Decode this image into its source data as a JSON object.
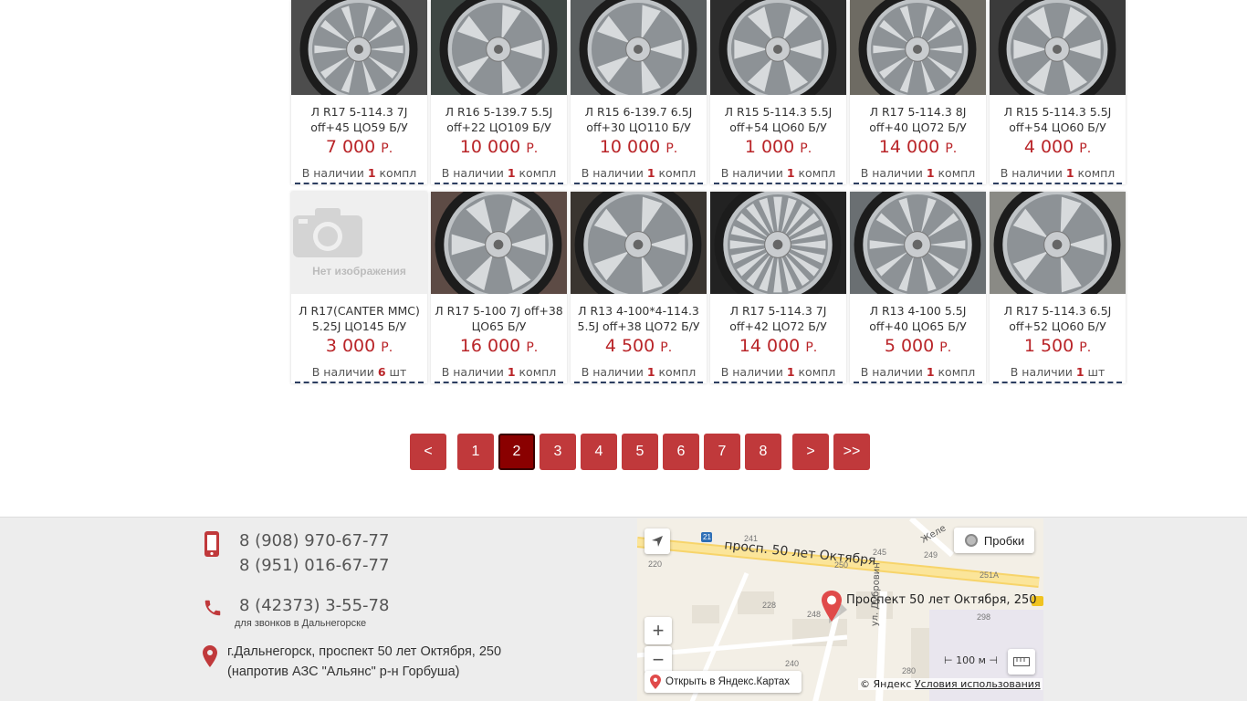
{
  "currency": "Р.",
  "stock_prefix": "В наличии",
  "rows": [
    [
      {
        "title_line1": "Л R17 5-114.3 7J",
        "title_line2": "off+45 ЦО59 Б/У",
        "price": "7 000",
        "qty": "1",
        "unit": "компл"
      },
      {
        "title_line1": "Л R16 5-139.7 5.5J",
        "title_line2": "off+22 ЦО109 Б/У",
        "price": "10 000",
        "qty": "1",
        "unit": "компл"
      },
      {
        "title_line1": "Л R15 6-139.7 6.5J",
        "title_line2": "off+30 ЦО110 Б/У",
        "price": "10 000",
        "qty": "1",
        "unit": "компл"
      },
      {
        "title_line1": "Л R15 5-114.3 5.5J",
        "title_line2": "off+54 ЦО60 Б/У",
        "price": "1 000",
        "qty": "1",
        "unit": "компл"
      },
      {
        "title_line1": "Л R17 5-114.3 8J",
        "title_line2": "off+40 ЦО72 Б/У",
        "price": "14 000",
        "qty": "1",
        "unit": "компл"
      },
      {
        "title_line1": "Л R15 5-114.3 5.5J",
        "title_line2": "off+54 ЦО60 Б/У",
        "price": "4 000",
        "qty": "1",
        "unit": "компл"
      }
    ],
    [
      {
        "title_line1": "Л R17(CANTER MMC)",
        "title_line2": "5.25J ЦО145 Б/У",
        "price": "3 000",
        "qty": "6",
        "unit": "шт"
      },
      {
        "title_line1": "Л R17 5-100 7J off+38",
        "title_line2": "ЦО65 Б/У",
        "price": "16 000",
        "qty": "1",
        "unit": "компл"
      },
      {
        "title_line1": "Л R13 4-100*4-114.3",
        "title_line2": "5.5J off+38 ЦО72 Б/У",
        "price": "4 500",
        "qty": "1",
        "unit": "компл"
      },
      {
        "title_line1": "Л R17 5-114.3 7J",
        "title_line2": "off+42 ЦО72 Б/У",
        "price": "14 000",
        "qty": "1",
        "unit": "компл"
      },
      {
        "title_line1": "Л R13 4-100 5.5J",
        "title_line2": "off+40 ЦО65 Б/У",
        "price": "5 000",
        "qty": "1",
        "unit": "компл"
      },
      {
        "title_line1": "Л R17 5-114.3 6.5J",
        "title_line2": "off+52 ЦО60 Б/У",
        "price": "1 500",
        "qty": "1",
        "unit": "шт"
      }
    ]
  ],
  "no_image_text": "Нет изображения",
  "pagination": {
    "prev": "<",
    "pages": [
      "1",
      "2",
      "3",
      "4",
      "5",
      "6",
      "7",
      "8"
    ],
    "current": "2",
    "next": ">",
    "last": ">>"
  },
  "footer": {
    "mobile1": "8 (908) 970-67-77",
    "mobile2": "8 (951) 016-67-77",
    "landline": "8 (42373) 3-55-78",
    "landline_note": "для звонков в Дальнегорске",
    "address_line1": "г.Дальнегорск, проспект 50 лет Октября, 250",
    "address_line2": "(напротив АЗС \"Альянс\" р-н Горбуша)"
  },
  "map": {
    "traffic_label": "Пробки",
    "street_label": "просп. 50 лет Октября",
    "street_label2": "ул. Дубровин",
    "street_label3": "Желе",
    "pin_label": "Проспект 50 лет Октября, 250",
    "open_label": "Открыть в Яндекс.Картах",
    "copyright": "© Яндекс",
    "terms": "Условия использования",
    "scale": "100 м",
    "zoom_in": "+",
    "zoom_out": "−",
    "road_number": "21",
    "house_numbers": [
      "241",
      "245",
      "249",
      "220",
      "250",
      "251А",
      "228",
      "248",
      "298",
      "240",
      "280"
    ]
  },
  "colors": {
    "accent": "#c0393b",
    "price": "#b92428",
    "active_page": "#8a0000"
  }
}
